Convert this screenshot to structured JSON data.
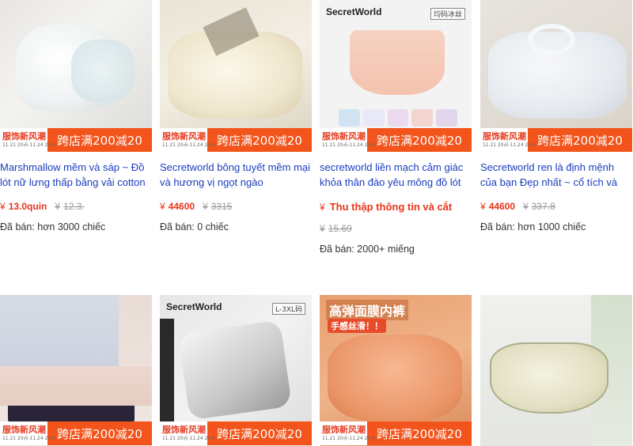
{
  "products": [
    {
      "title": "Marshmallow mềm và sáp ~ Đồ lót nữ lưng thấp bằng vải cotton",
      "currency": "¥",
      "price": "13.0quin",
      "original_price": "12.3.",
      "sold": "Đã bán: hơn 3000 chiếc",
      "promo_left": "服饰新风潮",
      "promo_dates": "11.21 20点-11.24 24点",
      "promo_right": "跨店满200减20"
    },
    {
      "title": "Secretworld bông tuyết mềm mại và hương vị ngọt ngào",
      "currency": "¥",
      "price": "44600",
      "original_price": "3315",
      "sold": "Đã bán: 0 chiếc",
      "promo_left": "服饰新风潮",
      "promo_dates": "11.21 20点-11.24 24点",
      "promo_right": "跨店满200减20"
    },
    {
      "title": "secretworld liền mạch cảm giác khỏa thân đào yêu mông đồ lót",
      "currency": "¥",
      "price": "Thu thập thông tin và cắt",
      "original_price": "15.69",
      "sold": "Đã bán: 2000+ miếng",
      "brand": "SecretWorld",
      "tag": "均码冰丝",
      "promo_left": "服饰新风潮",
      "promo_dates": "11.21 20点-11.24 24点",
      "promo_right": "跨店满200减20"
    },
    {
      "title": "Secretworld ren là định mệnh của bạn Đẹp nhất ~ cổ tích và",
      "currency": "¥",
      "price": "44600",
      "original_price": "337.8",
      "sold": "Đã bán: hơn 1000 chiếc",
      "promo_left": "服饰新风潮",
      "promo_dates": "11.21 20点-11.24 24点",
      "promo_right": "跨店满200减20"
    },
    {
      "promo_left": "服饰新风潮",
      "promo_dates": "11.21 20点-11.24 24点",
      "promo_right": "跨店满200减20"
    },
    {
      "brand": "SecretWorld",
      "tag": "L-3XL码",
      "promo_left": "服饰新风潮",
      "promo_dates": "11.21 20点-11.24 24点",
      "promo_right": "跨店满200减20"
    },
    {
      "cn_title": "高弹面膜内裤",
      "cn_sub": "手感丝滑！！",
      "promo_left": "服饰新风潮",
      "promo_dates": "11.21 20点-11.24 24点",
      "promo_right": "跨店满200减20"
    },
    {}
  ],
  "colors": {
    "title_link": "#1a3dbf",
    "price": "#e8341a",
    "promo_bg": "#f2541b",
    "strike": "#999999"
  }
}
